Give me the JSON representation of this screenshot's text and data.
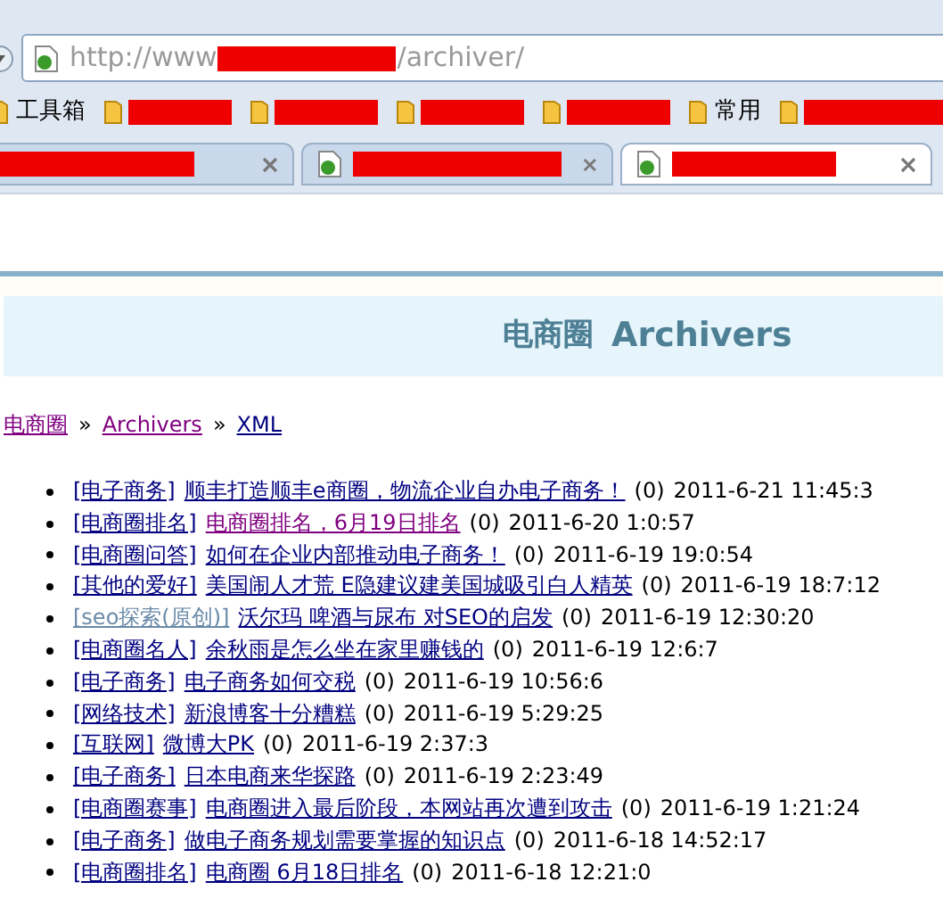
{
  "address_bar": {
    "url_prefix": "http://www",
    "url_suffix": "/archiver/"
  },
  "bookmarks": [
    {
      "label": "工具箱",
      "kind": "folder"
    },
    {
      "kind": "redacted"
    },
    {
      "kind": "redacted"
    },
    {
      "kind": "redacted"
    },
    {
      "kind": "redacted"
    },
    {
      "label": "常用",
      "kind": "folder"
    },
    {
      "kind": "redacted"
    }
  ],
  "tabs": [
    {
      "selected": false,
      "icon": false
    },
    {
      "selected": false,
      "icon": true
    },
    {
      "selected": true,
      "icon": true
    }
  ],
  "header": {
    "site": "电商圈",
    "title": "Archivers"
  },
  "breadcrumb": [
    {
      "label": "电商圈",
      "visited": true
    },
    {
      "label": "Archivers",
      "visited": true
    },
    {
      "label": "XML",
      "visited": false
    }
  ],
  "breadcrumb_separator": "»",
  "posts": [
    {
      "category": "[电子商务]",
      "category_visited": false,
      "title": "顺丰打造顺丰e商圈，物流企业自办电子商务！",
      "visited": false,
      "count": "(0)",
      "date": "2011-6-21 11:45:3"
    },
    {
      "category": "[电商圈排名]",
      "category_visited": false,
      "title": "电商圈排名，6月19日排名",
      "visited": true,
      "count": "(0)",
      "date": "2011-6-20 1:0:57"
    },
    {
      "category": "[电商圈问答]",
      "category_visited": false,
      "title": "如何在企业内部推动电子商务！",
      "visited": false,
      "count": "(0)",
      "date": "2011-6-19 19:0:54"
    },
    {
      "category": "[其他的爱好]",
      "category_visited": false,
      "title": "美国闹人才荒 E隐建议建美国城吸引白人精英",
      "visited": false,
      "count": "(0)",
      "date": "2011-6-19 18:7:12"
    },
    {
      "category": "[seo探索(原创)]",
      "category_visited": true,
      "title": "沃尔玛 啤酒与尿布 对SEO的启发",
      "visited": false,
      "count": "(0)",
      "date": "2011-6-19 12:30:20"
    },
    {
      "category": "[电商圈名人]",
      "category_visited": false,
      "title": "余秋雨是怎么坐在家里赚钱的",
      "visited": false,
      "count": "(0)",
      "date": "2011-6-19 12:6:7"
    },
    {
      "category": "[电子商务]",
      "category_visited": false,
      "title": "电子商务如何交税",
      "visited": false,
      "count": "(0)",
      "date": "2011-6-19 10:56:6"
    },
    {
      "category": "[网络技术]",
      "category_visited": false,
      "title": "新浪博客十分糟糕",
      "visited": false,
      "count": "(0)",
      "date": "2011-6-19 5:29:25"
    },
    {
      "category": "[互联网]",
      "category_visited": false,
      "title": "微博大PK",
      "visited": false,
      "count": "(0)",
      "date": "2011-6-19 2:37:3"
    },
    {
      "category": "[电子商务]",
      "category_visited": false,
      "title": "日本电商来华探路",
      "visited": false,
      "count": "(0)",
      "date": "2011-6-19 2:23:49"
    },
    {
      "category": "[电商圈赛事]",
      "category_visited": false,
      "title": "电商圈进入最后阶段，本网站再次遭到攻击",
      "visited": false,
      "count": "(0)",
      "date": "2011-6-19 1:21:24"
    },
    {
      "category": "[电子商务]",
      "category_visited": false,
      "title": "做电子商务规划需要掌握的知识点",
      "visited": false,
      "count": "(0)",
      "date": "2011-6-18 14:52:17"
    },
    {
      "category": "[电商圈排名]",
      "category_visited": false,
      "title": "电商圈 6月18日排名",
      "visited": false,
      "count": "(0)",
      "date": "2011-6-18 12:21:0"
    }
  ]
}
